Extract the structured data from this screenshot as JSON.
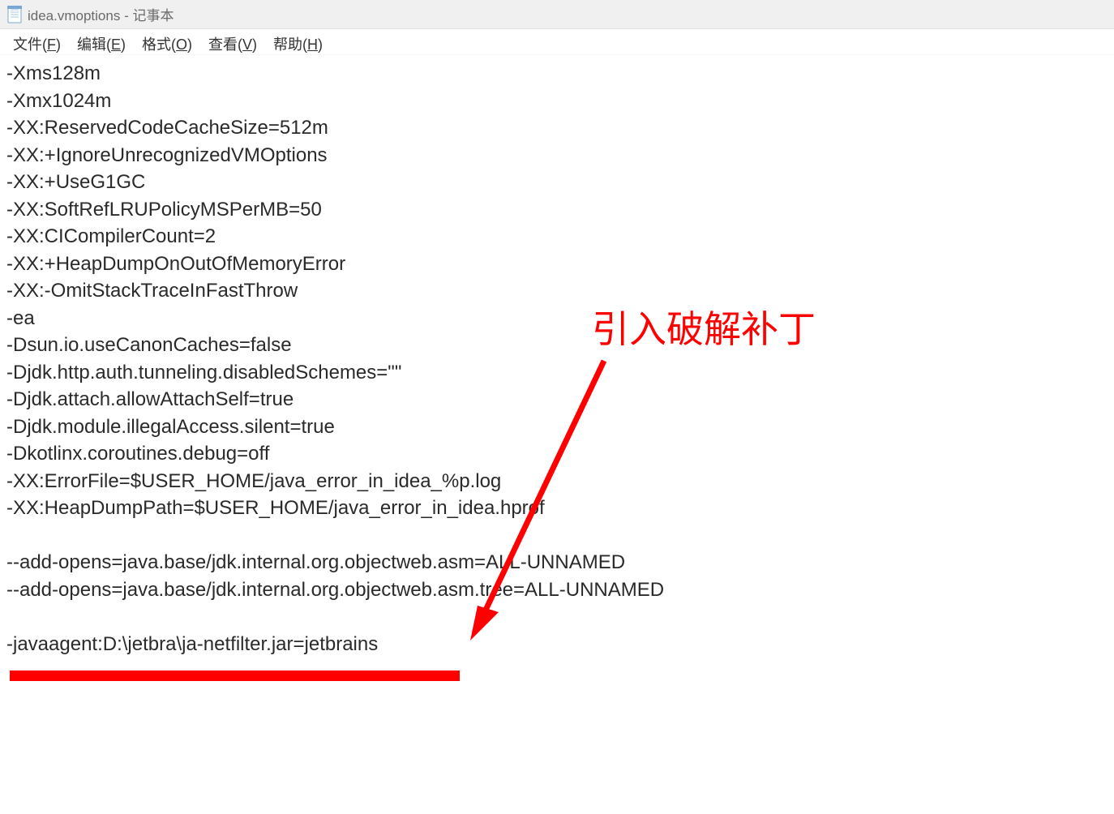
{
  "titlebar": {
    "filename": "idea.vmoptions",
    "app_name": "记事本"
  },
  "menubar": {
    "file": {
      "label": "文件",
      "mnemonic": "F"
    },
    "edit": {
      "label": "编辑",
      "mnemonic": "E"
    },
    "format": {
      "label": "格式",
      "mnemonic": "O"
    },
    "view": {
      "label": "查看",
      "mnemonic": "V"
    },
    "help": {
      "label": "帮助",
      "mnemonic": "H"
    }
  },
  "content": {
    "lines": [
      "-Xms128m",
      "-Xmx1024m",
      "-XX:ReservedCodeCacheSize=512m",
      "-XX:+IgnoreUnrecognizedVMOptions",
      "-XX:+UseG1GC",
      "-XX:SoftRefLRUPolicyMSPerMB=50",
      "-XX:CICompilerCount=2",
      "-XX:+HeapDumpOnOutOfMemoryError",
      "-XX:-OmitStackTraceInFastThrow",
      "-ea",
      "-Dsun.io.useCanonCaches=false",
      "-Djdk.http.auth.tunneling.disabledSchemes=\"\"",
      "-Djdk.attach.allowAttachSelf=true",
      "-Djdk.module.illegalAccess.silent=true",
      "-Dkotlinx.coroutines.debug=off",
      "-XX:ErrorFile=$USER_HOME/java_error_in_idea_%p.log",
      "-XX:HeapDumpPath=$USER_HOME/java_error_in_idea.hprof",
      "",
      "--add-opens=java.base/jdk.internal.org.objectweb.asm=ALL-UNNAMED",
      "--add-opens=java.base/jdk.internal.org.objectweb.asm.tree=ALL-UNNAMED",
      "",
      "-javaagent:D:\\jetbra\\ja-netfilter.jar=jetbrains"
    ]
  },
  "annotation": {
    "label": "引入破解补丁"
  }
}
